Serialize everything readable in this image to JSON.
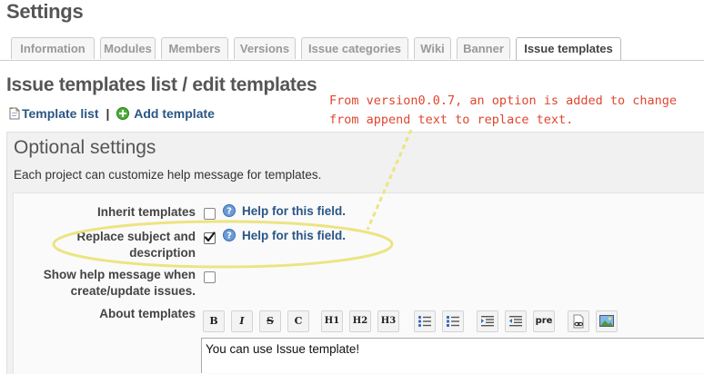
{
  "page": {
    "title": "Settings"
  },
  "tabs": [
    {
      "label": "Information"
    },
    {
      "label": "Modules"
    },
    {
      "label": "Members"
    },
    {
      "label": "Versions"
    },
    {
      "label": "Issue categories"
    },
    {
      "label": "Wiki"
    },
    {
      "label": "Banner"
    },
    {
      "label": "Issue templates"
    }
  ],
  "selected_tab": "Issue templates",
  "heading": "Issue templates list / edit templates",
  "links": {
    "template_list": "Template list",
    "separator": "|",
    "add_template": "Add template"
  },
  "annotation": {
    "line1": "From version0.0.7, an option is added to change",
    "line2": "from append text to replace text.",
    "color": "#e0462f"
  },
  "optional": {
    "heading": "Optional settings",
    "description": "Each project can customize help message for templates."
  },
  "fields": {
    "inherit": {
      "label": "Inherit templates",
      "checked": false,
      "help": "Help for this field."
    },
    "replace": {
      "label_line1": "Replace subject and",
      "label_line2": "description",
      "checked": true,
      "help": "Help for this field."
    },
    "show_help": {
      "label_line1": "Show help message when",
      "label_line2": "create/update issues.",
      "checked": false
    },
    "about": {
      "label": "About templates"
    }
  },
  "toolbar": {
    "bold": "B",
    "italic": "I",
    "strike": "S",
    "code": "C",
    "h1": "H1",
    "h2": "H2",
    "h3": "H3",
    "pre": "pre"
  },
  "editor": {
    "value": "You can use Issue template!"
  },
  "colors": {
    "link": "#2a5685",
    "highlight": "#e8e070"
  }
}
